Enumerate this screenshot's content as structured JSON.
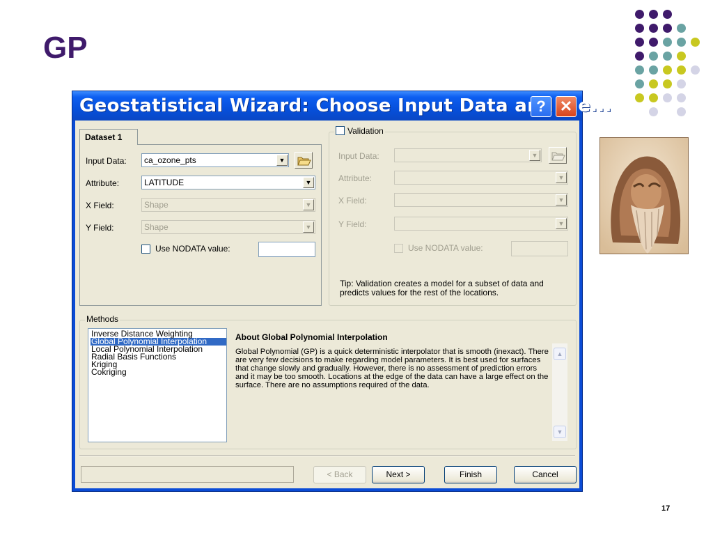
{
  "slide": {
    "title": "GP",
    "page_number": "17"
  },
  "decor": {
    "dot_colors": [
      "#3f1a6b",
      "#6aa3a3",
      "#c8c820",
      "#d4d4e6"
    ],
    "photo_icon": "bearded-wizard-portrait"
  },
  "dialog": {
    "title": "Geostatistical Wizard: Choose Input Data and Me...",
    "help_glyph": "?",
    "close_glyph": "✕",
    "dataset_tab": "Dataset 1",
    "input_data_label": "Input Data:",
    "input_data_value": "ca_ozone_pts",
    "attribute_label": "Attribute:",
    "attribute_value": "LATITUDE",
    "x_field_label": "X Field:",
    "x_field_value": "Shape",
    "y_field_label": "Y Field:",
    "y_field_value": "Shape",
    "use_nodata_label": "Use NODATA value:",
    "validation": {
      "title": "Validation",
      "input_data_label": "Input Data:",
      "attribute_label": "Attribute:",
      "x_field_label": "X Field:",
      "y_field_label": "Y Field:",
      "use_nodata_label": "Use NODATA value:",
      "tip": "Tip: Validation creates a model for a subset of data and predicts values for the rest of the locations."
    },
    "methods": {
      "title": "Methods",
      "items": [
        "Inverse Distance Weighting",
        "Global Polynomial Interpolation",
        "Local Polynomial Interpolation",
        "Radial Basis Functions",
        "Kriging",
        "Cokriging"
      ],
      "selected": "Global Polynomial Interpolation",
      "about_title": "About Global Polynomial Interpolation",
      "about_text": "Global Polynomial (GP) is a quick deterministic interpolator that is smooth (inexact). There are very few decisions to make regarding model parameters. It is best used for surfaces that change slowly and gradually. However, there is no assessment of prediction errors and it may be too smooth.  Locations at the edge of the data can have a large effect on the surface. There are no assumptions required of the data."
    },
    "buttons": {
      "back": "< Back",
      "next": "Next >",
      "finish": "Finish",
      "cancel": "Cancel"
    }
  }
}
